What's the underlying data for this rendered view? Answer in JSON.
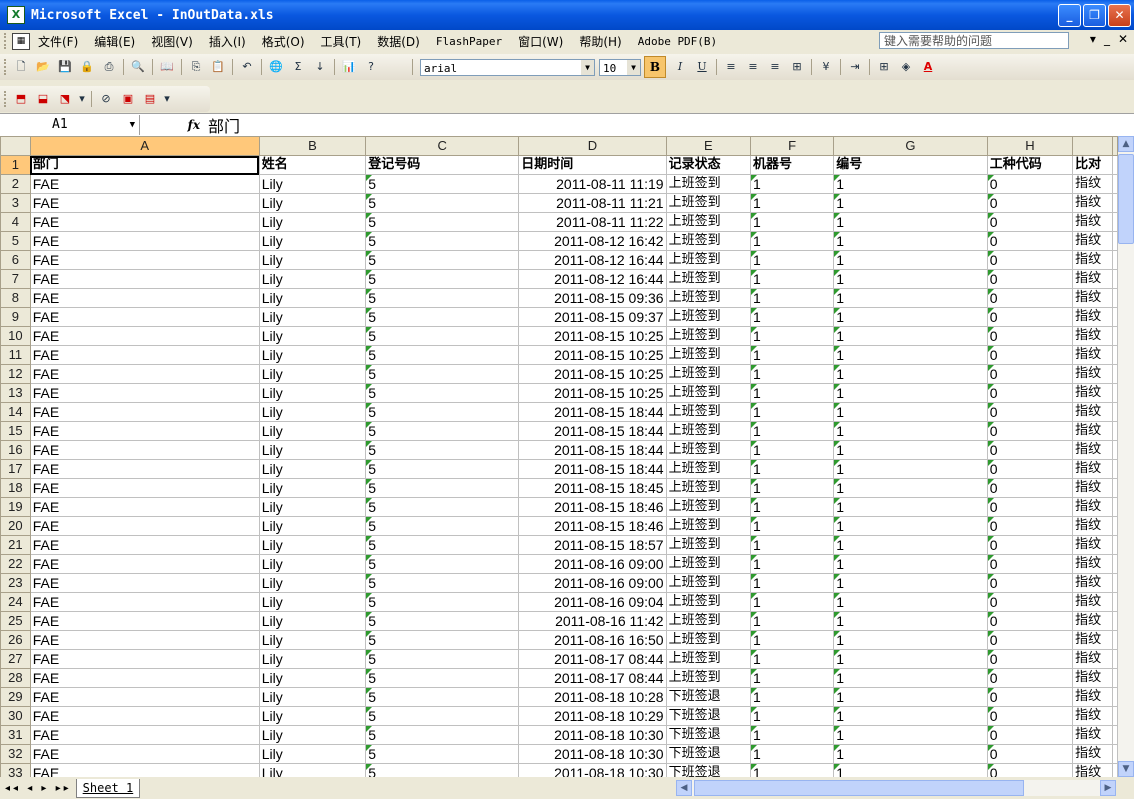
{
  "window": {
    "title": "Microsoft Excel - InOutData.xls",
    "app_icon": "excel-icon",
    "controls": [
      "_",
      "❐",
      "✕"
    ]
  },
  "menu": {
    "items": [
      "文件(F)",
      "编辑(E)",
      "视图(V)",
      "插入(I)",
      "格式(O)",
      "工具(T)",
      "数据(D)",
      "FlashPaper",
      "窗口(W)",
      "帮助(H)",
      "Adobe PDF(B)"
    ],
    "help_placeholder": "键入需要帮助的问题",
    "right_controls": [
      "▾",
      "_",
      "✕"
    ]
  },
  "toolbar": {
    "font_name": "arial",
    "font_size": "10",
    "bold": "B",
    "italic": "I",
    "underline": "U",
    "sigma": "Σ",
    "icons": [
      "new-icon",
      "open-icon",
      "save-icon",
      "permission-icon",
      "print-icon",
      "print-preview-icon",
      "research-icon",
      "copy-icon",
      "paste-icon",
      "undo-icon",
      "hyperlink-icon",
      "autosum-icon",
      "sort-icon",
      "chart-icon",
      "help-icon",
      "align-left-icon",
      "center-icon",
      "align-right-icon",
      "merge-center-icon",
      "currency-icon",
      "indent-icon",
      "borders-icon",
      "fill-color-icon",
      "font-color-icon"
    ]
  },
  "pdf_toolbar": {
    "icons": [
      "pdf-convert-icon",
      "pdf-email-icon",
      "pdf-review-icon",
      "flashpaper-icon",
      "flashpaper-print-icon",
      "flashpaper-pdf-icon"
    ]
  },
  "formula_bar": {
    "name_box": "A1",
    "fx": "fx",
    "value": "部门"
  },
  "sheet": {
    "columns": [
      "A",
      "B",
      "C",
      "D",
      "E",
      "F",
      "G",
      "H",
      ""
    ],
    "selected_col": "A",
    "header_row": [
      "部门",
      "姓名",
      "登记号码",
      "日期时间",
      "记录状态",
      "机器号",
      "编号",
      "工种代码",
      "比对"
    ],
    "rows": [
      [
        "FAE",
        "Lily",
        "5",
        "2011-08-11 11:19",
        "上班签到",
        "1",
        "1",
        "0",
        "指纹"
      ],
      [
        "FAE",
        "Lily",
        "5",
        "2011-08-11 11:21",
        "上班签到",
        "1",
        "1",
        "0",
        "指纹"
      ],
      [
        "FAE",
        "Lily",
        "5",
        "2011-08-11 11:22",
        "上班签到",
        "1",
        "1",
        "0",
        "指纹"
      ],
      [
        "FAE",
        "Lily",
        "5",
        "2011-08-12 16:42",
        "上班签到",
        "1",
        "1",
        "0",
        "指纹"
      ],
      [
        "FAE",
        "Lily",
        "5",
        "2011-08-12 16:44",
        "上班签到",
        "1",
        "1",
        "0",
        "指纹"
      ],
      [
        "FAE",
        "Lily",
        "5",
        "2011-08-12 16:44",
        "上班签到",
        "1",
        "1",
        "0",
        "指纹"
      ],
      [
        "FAE",
        "Lily",
        "5",
        "2011-08-15 09:36",
        "上班签到",
        "1",
        "1",
        "0",
        "指纹"
      ],
      [
        "FAE",
        "Lily",
        "5",
        "2011-08-15 09:37",
        "上班签到",
        "1",
        "1",
        "0",
        "指纹"
      ],
      [
        "FAE",
        "Lily",
        "5",
        "2011-08-15 10:25",
        "上班签到",
        "1",
        "1",
        "0",
        "指纹"
      ],
      [
        "FAE",
        "Lily",
        "5",
        "2011-08-15 10:25",
        "上班签到",
        "1",
        "1",
        "0",
        "指纹"
      ],
      [
        "FAE",
        "Lily",
        "5",
        "2011-08-15 10:25",
        "上班签到",
        "1",
        "1",
        "0",
        "指纹"
      ],
      [
        "FAE",
        "Lily",
        "5",
        "2011-08-15 10:25",
        "上班签到",
        "1",
        "1",
        "0",
        "指纹"
      ],
      [
        "FAE",
        "Lily",
        "5",
        "2011-08-15 18:44",
        "上班签到",
        "1",
        "1",
        "0",
        "指纹"
      ],
      [
        "FAE",
        "Lily",
        "5",
        "2011-08-15 18:44",
        "上班签到",
        "1",
        "1",
        "0",
        "指纹"
      ],
      [
        "FAE",
        "Lily",
        "5",
        "2011-08-15 18:44",
        "上班签到",
        "1",
        "1",
        "0",
        "指纹"
      ],
      [
        "FAE",
        "Lily",
        "5",
        "2011-08-15 18:44",
        "上班签到",
        "1",
        "1",
        "0",
        "指纹"
      ],
      [
        "FAE",
        "Lily",
        "5",
        "2011-08-15 18:45",
        "上班签到",
        "1",
        "1",
        "0",
        "指纹"
      ],
      [
        "FAE",
        "Lily",
        "5",
        "2011-08-15 18:46",
        "上班签到",
        "1",
        "1",
        "0",
        "指纹"
      ],
      [
        "FAE",
        "Lily",
        "5",
        "2011-08-15 18:46",
        "上班签到",
        "1",
        "1",
        "0",
        "指纹"
      ],
      [
        "FAE",
        "Lily",
        "5",
        "2011-08-15 18:57",
        "上班签到",
        "1",
        "1",
        "0",
        "指纹"
      ],
      [
        "FAE",
        "Lily",
        "5",
        "2011-08-16 09:00",
        "上班签到",
        "1",
        "1",
        "0",
        "指纹"
      ],
      [
        "FAE",
        "Lily",
        "5",
        "2011-08-16 09:00",
        "上班签到",
        "1",
        "1",
        "0",
        "指纹"
      ],
      [
        "FAE",
        "Lily",
        "5",
        "2011-08-16 09:04",
        "上班签到",
        "1",
        "1",
        "0",
        "指纹"
      ],
      [
        "FAE",
        "Lily",
        "5",
        "2011-08-16 11:42",
        "上班签到",
        "1",
        "1",
        "0",
        "指纹"
      ],
      [
        "FAE",
        "Lily",
        "5",
        "2011-08-16 16:50",
        "上班签到",
        "1",
        "1",
        "0",
        "指纹"
      ],
      [
        "FAE",
        "Lily",
        "5",
        "2011-08-17 08:44",
        "上班签到",
        "1",
        "1",
        "0",
        "指纹"
      ],
      [
        "FAE",
        "Lily",
        "5",
        "2011-08-17 08:44",
        "上班签到",
        "1",
        "1",
        "0",
        "指纹"
      ],
      [
        "FAE",
        "Lily",
        "5",
        "2011-08-18 10:28",
        "下班签退",
        "1",
        "1",
        "0",
        "指纹"
      ],
      [
        "FAE",
        "Lily",
        "5",
        "2011-08-18 10:29",
        "下班签退",
        "1",
        "1",
        "0",
        "指纹"
      ],
      [
        "FAE",
        "Lily",
        "5",
        "2011-08-18 10:30",
        "下班签退",
        "1",
        "1",
        "0",
        "指纹"
      ],
      [
        "FAE",
        "Lily",
        "5",
        "2011-08-18 10:30",
        "下班签退",
        "1",
        "1",
        "0",
        "指纹"
      ],
      [
        "FAE",
        "Lily",
        "5",
        "2011-08-18 10:30",
        "下班签退",
        "1",
        "1",
        "0",
        "指纹"
      ]
    ]
  },
  "sheet_tabs": {
    "nav": "◂◂ ◂ ▸ ▸▸",
    "tabs": [
      "Sheet 1"
    ]
  },
  "colors": {
    "titlebar": "#0a58e0",
    "selected_header": "#ffc87a",
    "text_marker": "#2f9a2f"
  }
}
